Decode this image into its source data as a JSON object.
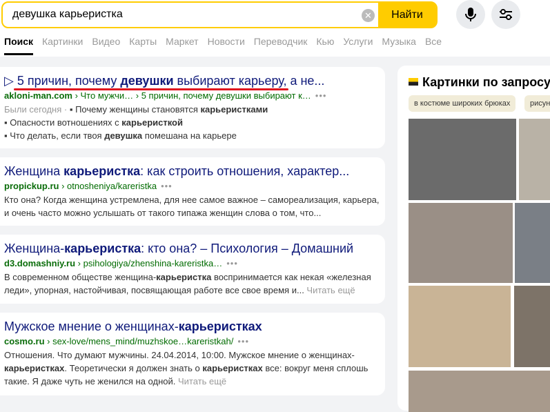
{
  "search": {
    "query": "девушка карьеристка",
    "button": "Найти"
  },
  "tabs": [
    "Поиск",
    "Картинки",
    "Видео",
    "Карты",
    "Маркет",
    "Новости",
    "Переводчик",
    "Кью",
    "Услуги",
    "Музыка",
    "Все"
  ],
  "results": [
    {
      "title_pre": "5 причин, почему ",
      "title_bold": "девушки",
      "title_post": " выбирают карьеру, а не...",
      "site": "akloni-man.com",
      "path": " › Что мужчи… › 5 причин, почему девушки выбирают к…",
      "visited": "Были сегодня ·",
      "sub": [
        {
          "pre": "Почему женщины становятся ",
          "bold": "карьеристками",
          "post": ""
        },
        {
          "pre": "Опасности вотношениях с ",
          "bold": "карьеристкой",
          "post": ""
        },
        {
          "pre": "Что делать, если твоя ",
          "bold": "девушка",
          "post": " помешана на карьере"
        }
      ]
    },
    {
      "title_pre": "Женщина ",
      "title_bold": "карьеристка",
      "title_post": ": как строить отношения, характер...",
      "site": "propickup.ru",
      "path": " › otnosheniya/kareristka",
      "snippet": "Кто она? Когда женщина устремлена, для нее самое важное – самореализация, карьера, и очень часто можно услышать от такого типажа женщин слова о том, что..."
    },
    {
      "title_pre": "Женщина-",
      "title_bold": "карьеристка",
      "title_post": ": кто она? – Психология – Домашний",
      "site": "d3.domashniy.ru",
      "path": " › psihologiya/zhenshina-kareristka…",
      "snippet_pre": "В современном обществе женщина-",
      "snippet_bold": "карьеристка",
      "snippet_post": " воспринимается как некая «железная леди», упорная, настойчивая, посвящающая работе все свое время и... ",
      "more": "Читать ещё"
    },
    {
      "title_pre": "Мужское мнение о женщинах-",
      "title_bold": "карьеристках",
      "title_post": "",
      "site": "cosmo.ru",
      "path": " › sex-love/mens_mind/muzhskoe…kareristkah/",
      "s1": "Отношения. Что думают мужчины. 24.04.2014, 10:00. Мужское мнение о женщинах-",
      "s2": "карьеристках",
      "s3": ". Теоретически я должен знать о ",
      "s4": "карьеристках",
      "s5": " все: вокруг меня сплошь такие. Я даже чуть не женился на одной. ",
      "more": "Читать ещё"
    }
  ],
  "images": {
    "title": "Картинки по запросу",
    "chips": [
      "в костюме широких брюках",
      "рисунок"
    ]
  },
  "colors": {
    "accent": "#ffcc00",
    "link": "#0f1a7a",
    "url": "#006b00"
  }
}
